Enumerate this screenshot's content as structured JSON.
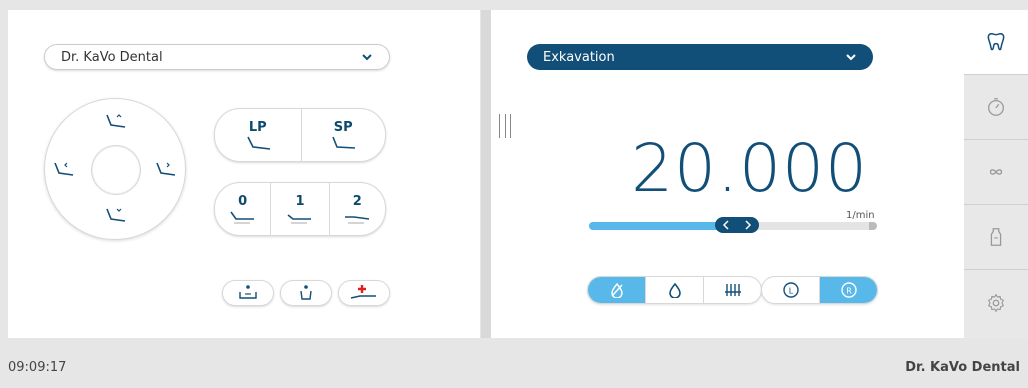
{
  "left": {
    "profile_dropdown": {
      "label": "Dr. KaVo Dental"
    },
    "positions_top": [
      {
        "label": "LP"
      },
      {
        "label": "SP"
      }
    ],
    "positions_bottom": [
      {
        "label": "0"
      },
      {
        "label": "1"
      },
      {
        "label": "2"
      }
    ],
    "small_buttons": [
      "cup-fill-icon",
      "cup-icon",
      "emergency-position-icon"
    ]
  },
  "right": {
    "instrument_dropdown": {
      "label": "Exkavation"
    },
    "speed": {
      "value": "20.000",
      "unit": "1/min",
      "level_fraction": 0.44
    },
    "modes": [
      {
        "icon": "no-water-icon",
        "active": true
      },
      {
        "icon": "water-drop-icon",
        "active": false
      },
      {
        "icon": "spray-icon",
        "active": false
      }
    ],
    "direction": [
      {
        "icon": "rotation-left-icon",
        "label": "L",
        "active": false
      },
      {
        "icon": "rotation-right-icon",
        "label": "R",
        "active": true
      }
    ]
  },
  "sidebar": {
    "items": [
      "tooth-icon",
      "timer-icon",
      "infinity-icon",
      "bottle-icon",
      "settings-icon"
    ]
  },
  "status": {
    "time": "09:09:17",
    "user": "Dr. KaVo Dental"
  },
  "colors": {
    "primary": "#124f78",
    "accent": "#58b8ea"
  }
}
